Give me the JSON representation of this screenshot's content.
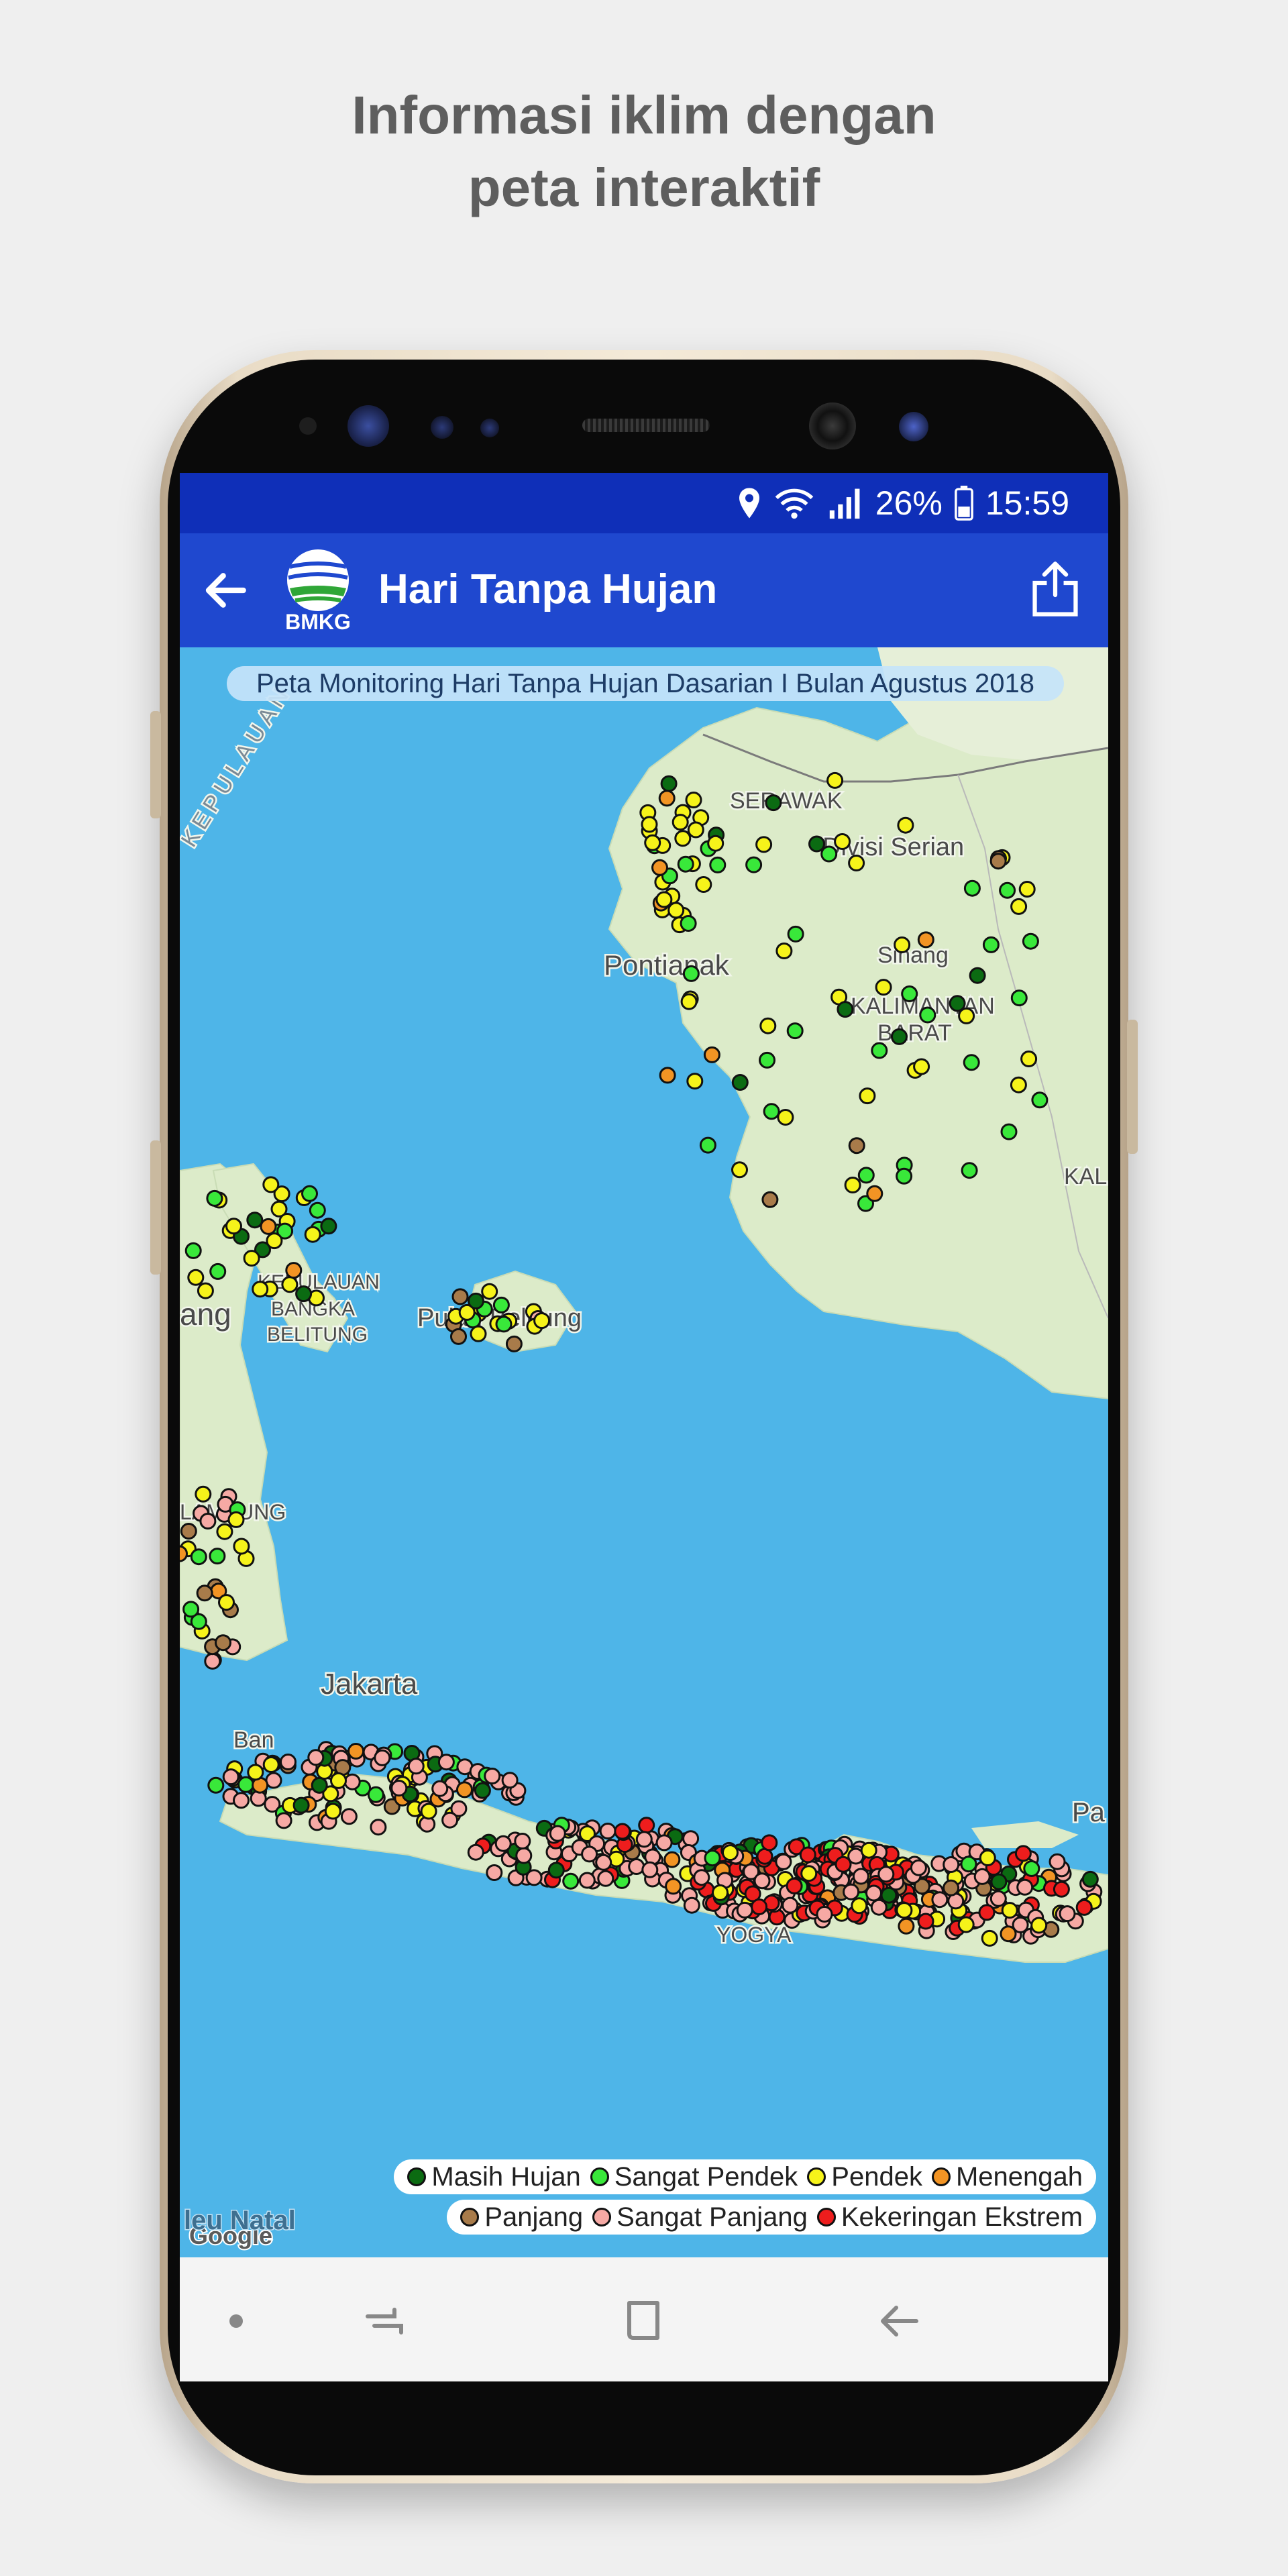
{
  "promo": {
    "line1": "Informasi iklim dengan",
    "line2": "peta interaktif"
  },
  "status_bar": {
    "battery_percent": "26%",
    "time": "15:59",
    "icons": [
      "location-icon",
      "wifi-icon",
      "signal-icon",
      "battery-icon"
    ]
  },
  "app_bar": {
    "title": "Hari Tanpa Hujan",
    "logo_text": "BMKG",
    "back_icon": "arrow-left-icon",
    "share_icon": "share-icon"
  },
  "map": {
    "banner": "Peta Monitoring Hari Tanpa Hujan Dasarian I Bulan Agustus 2018",
    "place_labels": [
      "KEPULAUAN",
      "SERAWAK",
      "Divisi Serian",
      "Pontianak",
      "Sinang",
      "KALIMANTAN",
      "BARAT",
      "KAL",
      "ang",
      "KEPULAUAN",
      "BANGKA",
      "BELITUNG",
      "Pulau Belitung",
      "LAMPUNG",
      "Jakarta",
      "Ban",
      "YOGYA",
      "Pa"
    ],
    "attribution": "Google",
    "attribution_overlay": "leu Natal"
  },
  "legend": {
    "items": [
      {
        "label": "Masih Hujan",
        "color": "#0b6b12"
      },
      {
        "label": "Sangat Pendek",
        "color": "#39e83a"
      },
      {
        "label": "Pendek",
        "color": "#f6f31a"
      },
      {
        "label": "Menengah",
        "color": "#f29424"
      },
      {
        "label": "Panjang",
        "color": "#a87b4a"
      },
      {
        "label": "Sangat Panjang",
        "color": "#f6a9a4"
      },
      {
        "label": "Kekeringan Ekstrem",
        "color": "#ee1d1d"
      }
    ]
  },
  "nav_bar": {
    "icons": [
      "dot-icon",
      "recents-icon",
      "home-icon",
      "back-icon"
    ]
  },
  "colors": {
    "status_bar": "#0f2fb8",
    "app_bar": "#1f48cf",
    "sea": "#4eb5e8",
    "land": "#dcebc9"
  }
}
